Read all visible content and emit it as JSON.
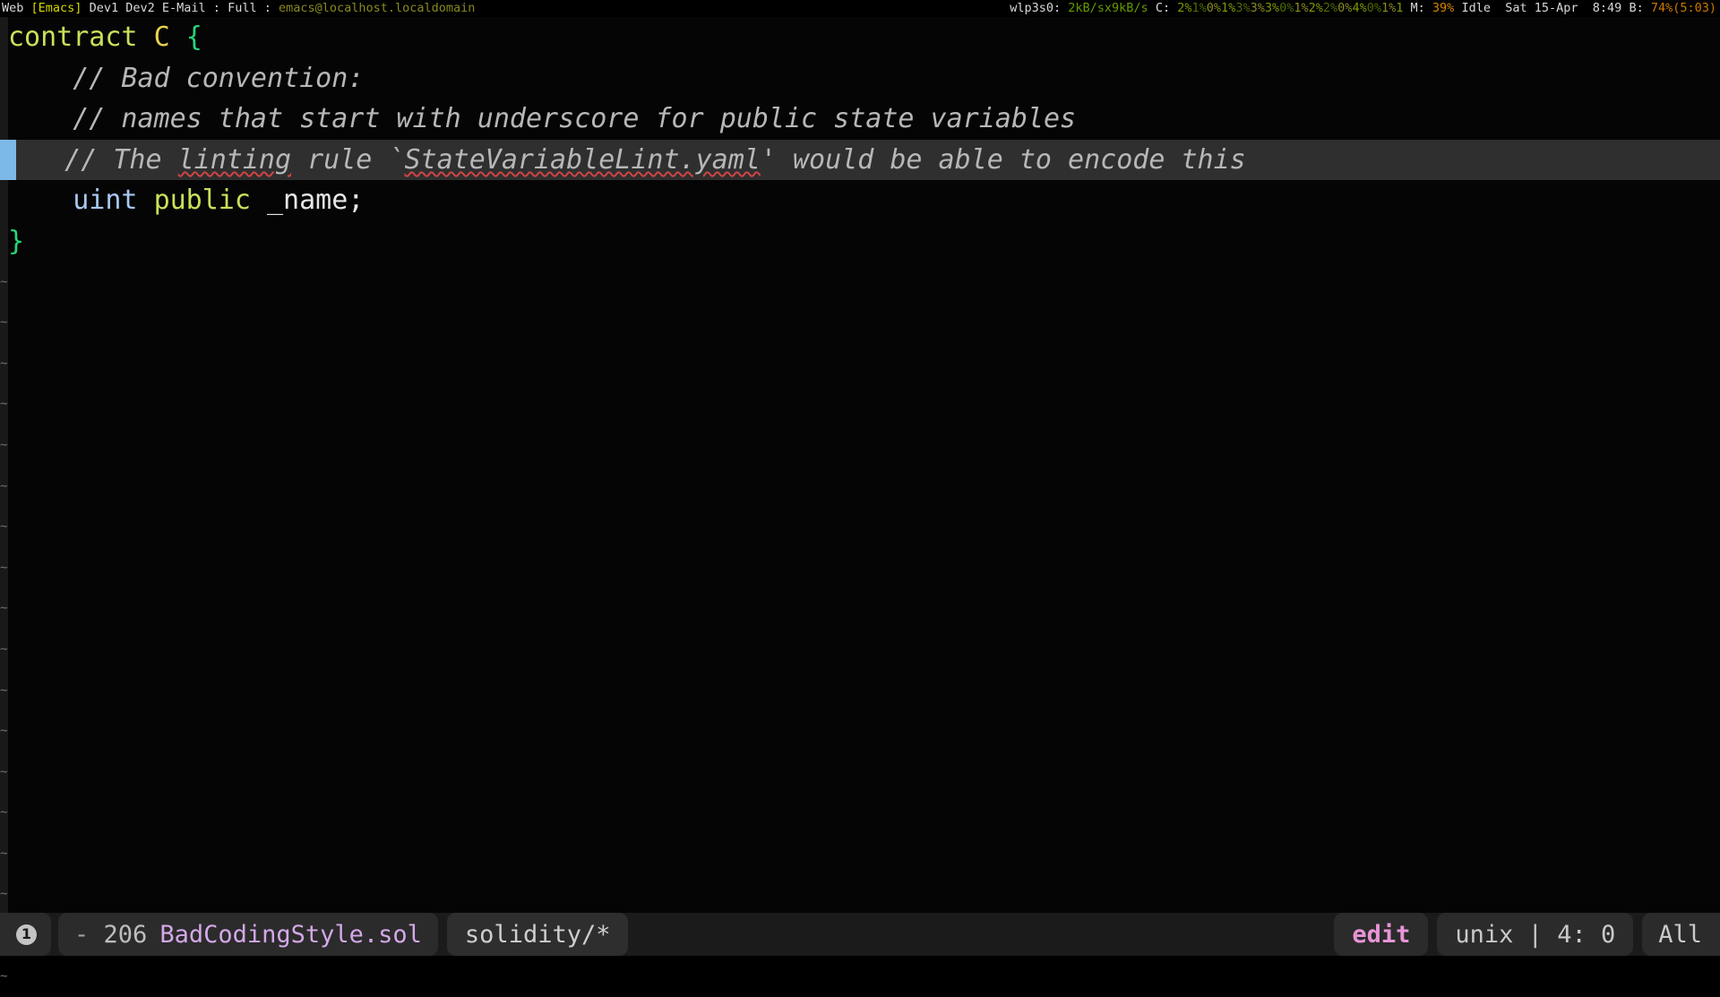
{
  "top_bar": {
    "workspaces": [
      "Web",
      "[Emacs]",
      "Dev1",
      "Dev2",
      "E-Mail"
    ],
    "sep1": " : ",
    "layout": "Full",
    "sep2": " : ",
    "host": "emacs@localhost.localdomain",
    "network_iface": "wlp3s0:",
    "net_down": "2kB/s",
    "net_up": "x9kB/s",
    "cpu_label": "C:",
    "cpu_cores": [
      "2%",
      "1%",
      "0%",
      "1%",
      "3%",
      "3%",
      "3%",
      "0%",
      "1%",
      "2%",
      "2%",
      "0%",
      "4%",
      "0%",
      "1%",
      "1"
    ],
    "mem_label": "M:",
    "mem_value": "39%",
    "idle_label": "Idle",
    "date": "Sat 15-Apr",
    "time": "8:49",
    "battery_label": "B:",
    "battery_value": "74%(5:03)",
    "colors": {
      "active_workspace": "#d7d700",
      "host": "#8a8a20",
      "net": "#d7d700",
      "mem": "#cc7a00",
      "battery": "#cc7a00"
    }
  },
  "editor": {
    "gutter_tilde": "~",
    "tilde_row_count": 18,
    "lines": [
      {
        "id": "line-1",
        "current": false,
        "tokens": [
          {
            "text": "contract ",
            "cls": "s-kw"
          },
          {
            "text": "C",
            "cls": "s-name"
          },
          {
            "text": " ",
            "cls": "s-plain"
          },
          {
            "text": "{",
            "cls": "s-brace"
          }
        ]
      },
      {
        "id": "line-2",
        "current": false,
        "tokens": [
          {
            "text": "    // Bad convention:",
            "cls": "s-comment"
          }
        ]
      },
      {
        "id": "line-3",
        "current": false,
        "tokens": [
          {
            "text": "    // names that start with underscore for public state variables",
            "cls": "s-comment"
          }
        ]
      },
      {
        "id": "line-4",
        "current": true,
        "tokens": [
          {
            "text": "   // The ",
            "cls": "s-comment"
          },
          {
            "text": "linting",
            "cls": "s-comment misspell"
          },
          {
            "text": " rule `",
            "cls": "s-comment"
          },
          {
            "text": "StateVariableLint.yaml",
            "cls": "s-comment misspell"
          },
          {
            "text": "' would be able to encode this",
            "cls": "s-comment"
          }
        ]
      },
      {
        "id": "line-5",
        "current": false,
        "tokens": [
          {
            "text": "    ",
            "cls": "s-plain"
          },
          {
            "text": "uint",
            "cls": "s-type"
          },
          {
            "text": " ",
            "cls": "s-plain"
          },
          {
            "text": "public",
            "cls": "s-kw"
          },
          {
            "text": " _name;",
            "cls": "s-plain"
          }
        ]
      },
      {
        "id": "line-6",
        "current": false,
        "tokens": [
          {
            "text": "}",
            "cls": "s-brace"
          }
        ]
      }
    ]
  },
  "mode_line": {
    "info_icon_glyph": "1",
    "modified_indicator": "-",
    "buffer_size": "206",
    "file_name": "BadCodingStyle.sol",
    "major_mode": "solidity/*",
    "edit_state": "edit",
    "coding_system": "unix | 4: 0",
    "scroll_position": "All"
  }
}
